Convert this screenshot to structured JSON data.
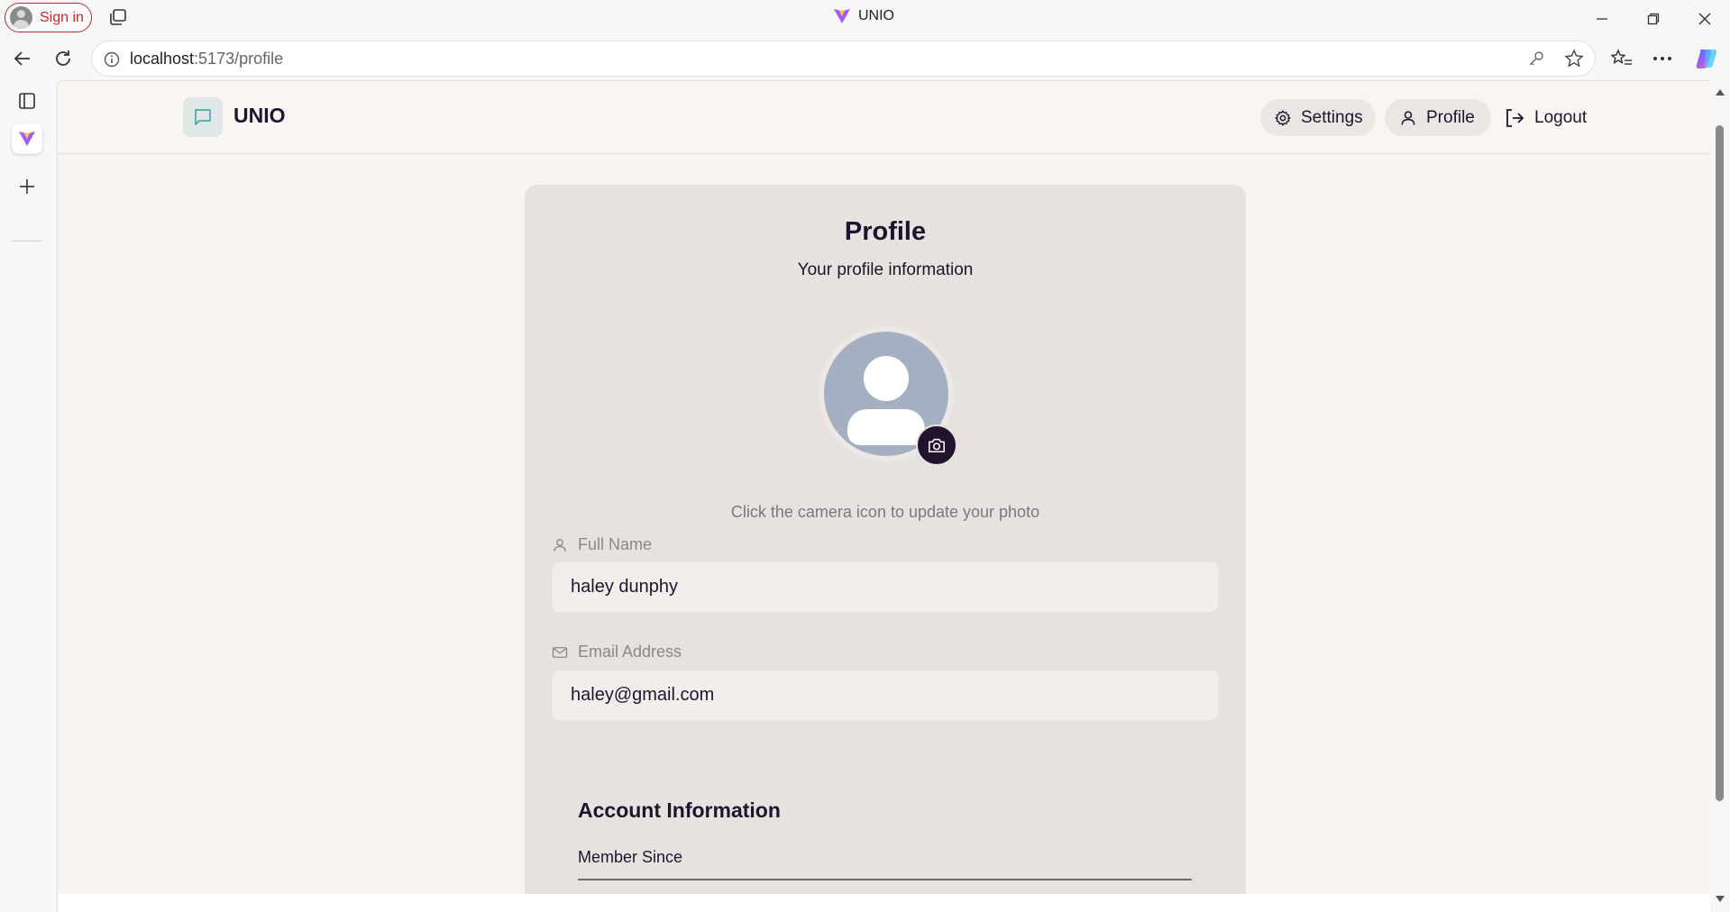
{
  "browser": {
    "signin_label": "Sign in",
    "window_title": "UNIO",
    "url_host": "localhost",
    "url_path": ":5173/profile"
  },
  "app": {
    "brand": "UNIO",
    "nav": {
      "settings_label": "Settings",
      "profile_label": "Profile",
      "logout_label": "Logout"
    }
  },
  "profile": {
    "title": "Profile",
    "subtitle": "Your profile information",
    "photo_hint": "Click the camera icon to update your photo",
    "full_name_label": "Full Name",
    "full_name_value": "haley dunphy",
    "email_label": "Email Address",
    "email_value": "haley@gmail.com",
    "account_section_title": "Account Information",
    "member_since_label": "Member Since"
  },
  "colors": {
    "brand_dark": "#1c1530",
    "card_bg": "#e7e2df",
    "avatar_bg": "#a4b0c2",
    "camera_btn": "#24132e",
    "signin_accent": "#c42b2b"
  }
}
